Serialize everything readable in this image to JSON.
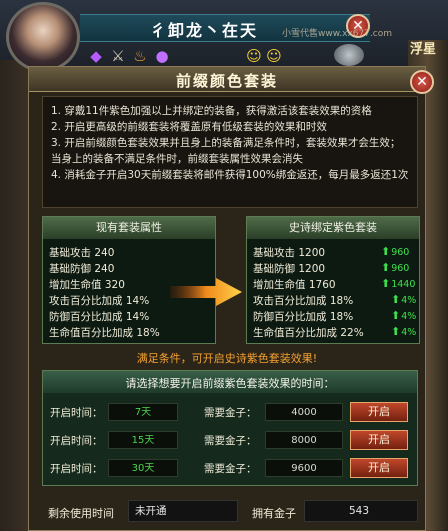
{
  "header": {
    "player_name": "彳卸龙丶在天",
    "close_glyph": "✕",
    "watermark": "小雪代售www.xx677.com",
    "corner_text": "浮星",
    "icons": [
      "purple-gem-icon",
      "crossed-swords-icon",
      "flame-icon",
      "purple-orb-icon",
      "smiley-icon",
      "smiley-icon"
    ]
  },
  "panel": {
    "title": "前缀颜色套装",
    "close_glyph": "✕"
  },
  "rules": [
    "1. 穿戴11件紫色加强以上并绑定的装备，获得激活该套装效果的资格",
    "2. 开启更高级的前缀套装将覆盖原有低级套装的效果和时效",
    "3. 开启前缀颜色套装效果并且身上的装备满足条件时，套装效果才会生效；当身上的装备不满足条件时，前缀套装属性效果会消失",
    "4. 消耗金子开启30天前缀套装将邮件获得100%绑金返还，每月最多返还1次"
  ],
  "current_set": {
    "title": "现有套装属性",
    "rows": [
      {
        "label": "基础攻击",
        "value": "240"
      },
      {
        "label": "基础防御",
        "value": "240"
      },
      {
        "label": "增加生命值",
        "value": "320"
      },
      {
        "label": "攻击百分比加成",
        "value": "14%"
      },
      {
        "label": "防御百分比加成",
        "value": "14%"
      },
      {
        "label": "生命值百分比加成",
        "value": "18%"
      }
    ]
  },
  "epic_set": {
    "title": "史诗绑定紫色套装",
    "rows": [
      {
        "label": "基础攻击",
        "value": "1200",
        "gain": "960"
      },
      {
        "label": "基础防御",
        "value": "1200",
        "gain": "960"
      },
      {
        "label": "增加生命值",
        "value": "1760",
        "gain": "1440"
      },
      {
        "label": "攻击百分比加成",
        "value": "18%",
        "gain": "4%"
      },
      {
        "label": "防御百分比加成",
        "value": "18%",
        "gain": "4%"
      },
      {
        "label": "生命值百分比加成",
        "value": "22%",
        "gain": "4%"
      }
    ]
  },
  "condition_text": "满足条件，可开启史诗紫色套装效果!",
  "select": {
    "title": "请选择想要开启前缀紫色套装效果的时间：",
    "options": [
      {
        "time_label": "开启时间：",
        "time": "7天",
        "cost_label": "需要金子：",
        "cost": "4000",
        "button": "开启"
      },
      {
        "time_label": "开启时间：",
        "time": "15天",
        "cost_label": "需要金子：",
        "cost": "8000",
        "button": "开启"
      },
      {
        "time_label": "开启时间：",
        "time": "30天",
        "cost_label": "需要金子：",
        "cost": "9600",
        "button": "开启"
      }
    ]
  },
  "footer": {
    "remaining_label": "剩余使用时间",
    "remaining_value": "未开通",
    "gold_label": "拥有金子",
    "gold_value": "543"
  },
  "colors": {
    "gain_green": "#3ee04a",
    "condition_orange": "#f4a030",
    "button_red": "#c0472b"
  }
}
